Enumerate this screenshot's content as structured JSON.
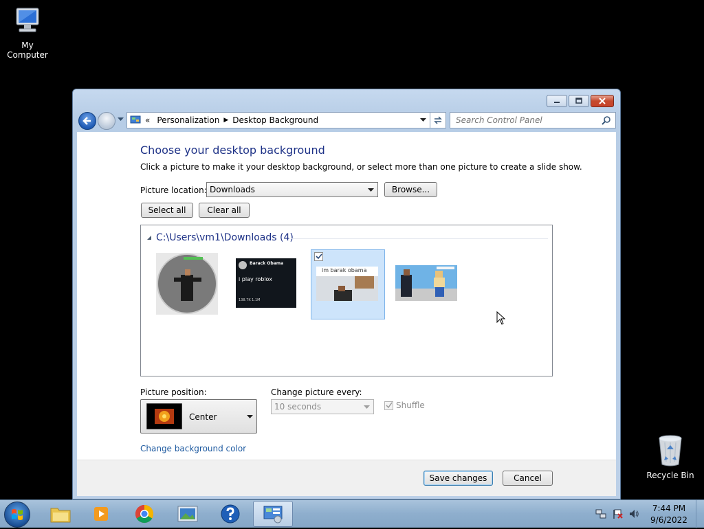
{
  "desktop": {
    "my_computer_label": "My Computer",
    "recycle_bin_label": "Recycle Bin"
  },
  "window": {
    "address": {
      "prefix": "«",
      "crumbs": [
        "Personalization",
        "Desktop Background"
      ]
    },
    "search_placeholder": "Search Control Panel",
    "title": "Choose your desktop background",
    "instructions": "Click a picture to make it your desktop background, or select more than one picture to create a slide show.",
    "picture_location_label": "Picture location:",
    "picture_location_value": "Downloads",
    "browse_label": "Browse...",
    "select_all_label": "Select all",
    "clear_all_label": "Clear all",
    "gallery": {
      "group_title": "C:\\Users\\vm1\\Downloads (4)",
      "items": [
        {
          "name": "image-1",
          "selected": false
        },
        {
          "name": "image-2",
          "selected": false,
          "tweet_author": "Barack Obama",
          "tweet_text": "i play roblox",
          "tweet_stats": "138.7K   1.1M"
        },
        {
          "name": "image-3",
          "selected": true,
          "caption": "im barak obama"
        },
        {
          "name": "image-4",
          "selected": false
        }
      ]
    },
    "picture_position_label": "Picture position:",
    "picture_position_value": "Center",
    "change_every_label": "Change picture every:",
    "change_every_value": "10 seconds",
    "shuffle_label": "Shuffle",
    "change_bg_color_link": "Change background color",
    "save_label": "Save changes",
    "cancel_label": "Cancel"
  },
  "taskbar": {
    "time": "7:44 PM",
    "date": "9/6/2022"
  },
  "colors": {
    "title_blue": "#1e3287",
    "link_blue": "#1e5aa0",
    "selection": "#cde4fb"
  }
}
